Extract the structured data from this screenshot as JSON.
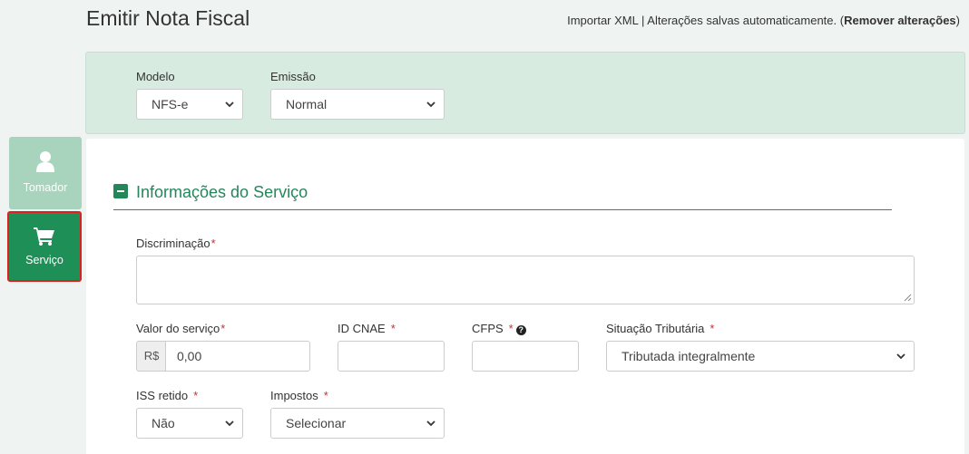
{
  "header": {
    "title": "Emitir Nota Fiscal",
    "import_xml": "Importar XML",
    "separator": "|",
    "autosave_text": "Alterações salvas automaticamente. (",
    "remove_changes": "Remover alterações",
    "close_paren": ")"
  },
  "model_panel": {
    "modelo_label": "Modelo",
    "modelo_value": "NFS-e",
    "emissao_label": "Emissão",
    "emissao_value": "Normal"
  },
  "sidebar": {
    "items": [
      {
        "label": "Tomador",
        "icon": "user-icon"
      },
      {
        "label": "Serviço",
        "icon": "cart-icon"
      }
    ]
  },
  "section": {
    "title": "Informações do Serviço"
  },
  "form": {
    "required_mark": "*",
    "discriminacao_label": "Discriminação",
    "discriminacao_value": "",
    "valor_label": "Valor do serviço",
    "valor_prefix": "R$",
    "valor_value": "0,00",
    "cnae_label": "ID CNAE",
    "cnae_value": "",
    "cfps_label": "CFPS",
    "cfps_value": "",
    "help_glyph": "?",
    "situacao_label": "Situação Tributária",
    "situacao_value": "Tributada integralmente",
    "iss_label": "ISS retido",
    "iss_value": "Não",
    "impostos_label": "Impostos",
    "impostos_value": "Selecionar"
  },
  "colors": {
    "accent": "#23875a",
    "panel_bg": "#d7ebe1",
    "sidebar_active": "#1f8f58",
    "sidebar_inactive": "#a8d3bc",
    "required": "#c9302c",
    "highlight_border": "#e0201f"
  }
}
